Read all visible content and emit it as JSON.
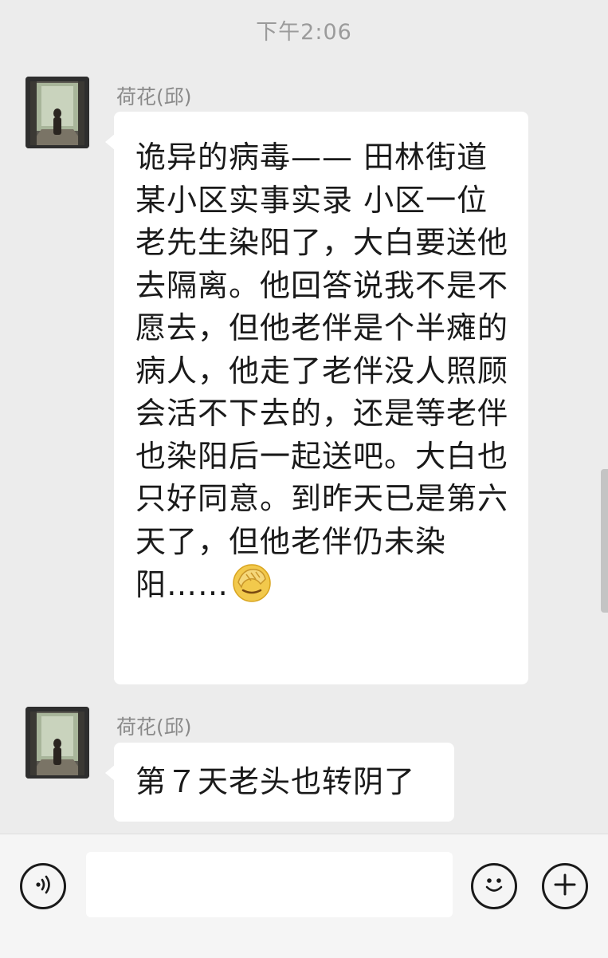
{
  "status": {
    "time": "下午2:06"
  },
  "messages": [
    {
      "sender": "荷花(邱)",
      "text": "诡异的病毒—— 田林街道某小区实事实录 小区一位老先生染阳了，大白要送他去隔离。他回答说我不是不愿去，但他老伴是个半瘫的病人，他走了老伴没人照顾会活不下去的，还是等老伴也染阳后一起送吧。大白也只好同意。到昨天已是第六天了，但他老伴仍未染阳……",
      "trailing_emoji": "facepalm-emoji"
    },
    {
      "sender": "荷花(邱)",
      "text": "第７天老头也转阴了"
    }
  ],
  "input_bar": {
    "input_value": "",
    "voice_icon": "voice-icon",
    "emoji_icon": "emoji-icon",
    "more_icon": "plus-icon"
  }
}
